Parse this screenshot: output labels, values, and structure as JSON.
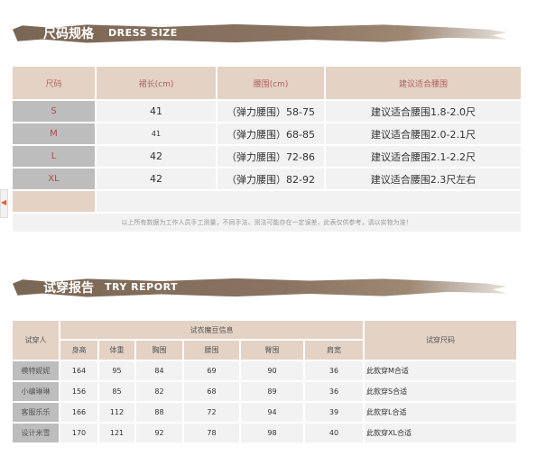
{
  "size_section": {
    "title_cn": "尺码规格",
    "title_en": "DRESS SIZE",
    "headers": [
      "尺码",
      "裙长(cm)",
      "腰围(cm)",
      "建议适合腰围"
    ],
    "rows": [
      {
        "size": "S",
        "length": "41",
        "waist": "（弹力腰围）58-75",
        "suggest": "建议适合腰围1.8-2.0尺"
      },
      {
        "size": "M",
        "length": "41",
        "waist": "（弹力腰围）68-85",
        "suggest": "建议适合腰围2.0-2.1尺"
      },
      {
        "size": "L",
        "length": "42",
        "waist": "（弹力腰围）72-86",
        "suggest": "建议适合腰围2.1-2.2尺"
      },
      {
        "size": "XL",
        "length": "42",
        "waist": "（弹力腰围）82-92",
        "suggest": "建议适合腰围2.3尺左右"
      }
    ],
    "note": "以上所有数据为工作人员手工测量，不同手法、测法可能存在一定误差，此表仅供参考，请以实物为准！"
  },
  "try_section": {
    "title_cn": "试穿报告",
    "title_en": "TRY REPORT",
    "col_tester": "试穿人",
    "col_info": "试衣魔豆信息",
    "col_result": "试穿尺码",
    "sub_headers": [
      "身高",
      "体重",
      "胸围",
      "腰围",
      "臀围",
      "肩宽"
    ],
    "rows": [
      {
        "name": "模特妮妮",
        "height": "164",
        "weight": "95",
        "chest": "84",
        "waist": "69",
        "hip": "90",
        "shoulder": "36",
        "result": "此款穿M合适"
      },
      {
        "name": "小编琳琳",
        "height": "156",
        "weight": "85",
        "chest": "82",
        "waist": "68",
        "hip": "89",
        "shoulder": "36",
        "result": "此款穿S合适"
      },
      {
        "name": "客服乐乐",
        "height": "166",
        "weight": "112",
        "chest": "88",
        "waist": "72",
        "hip": "94",
        "shoulder": "39",
        "result": "此款穿L合适"
      },
      {
        "name": "设计米雪",
        "height": "170",
        "weight": "121",
        "chest": "92",
        "waist": "78",
        "hip": "98",
        "shoulder": "40",
        "result": "此款穿XL合适"
      }
    ]
  },
  "side_tab": {
    "arrow": "◀"
  },
  "colors": {
    "banner": "#7a6654",
    "header_bg": "#e4d2c5",
    "header_text": "#b06262",
    "size_cell_bg": "#bdbdbd",
    "row_bg": "#f2f2f2"
  }
}
